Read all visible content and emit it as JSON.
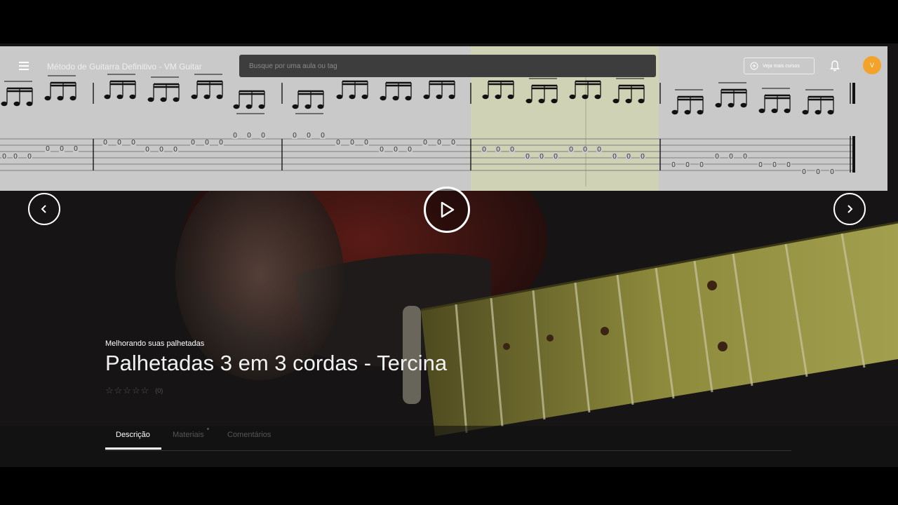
{
  "header": {
    "app_title": "Método de Guitarra Definitivo - VM Guitar",
    "search_placeholder": "Busque por uma aula ou tag",
    "more_courses_label": "Veja mais cursos",
    "avatar_initial": "V"
  },
  "lesson": {
    "course_label": "Melhorando suas palhetadas",
    "title": "Palhetadas 3 em 3 cordas - Tercina",
    "rating_count": "(0)"
  },
  "tabs": [
    {
      "label": "Descrição",
      "active": true
    },
    {
      "label": "Materiais",
      "active": false
    },
    {
      "label": "Comentários",
      "active": false
    }
  ],
  "icons": {
    "menu": "menu-icon",
    "more_courses": "plus-circle-icon",
    "bell": "bell-icon",
    "prev": "chevron-left-icon",
    "next": "chevron-right-icon",
    "play": "play-icon",
    "star": "star-icon"
  },
  "colors": {
    "avatar": "#f3a32a",
    "sheet_bg": "#c9c9c9",
    "highlight": "#d6d9a6"
  }
}
